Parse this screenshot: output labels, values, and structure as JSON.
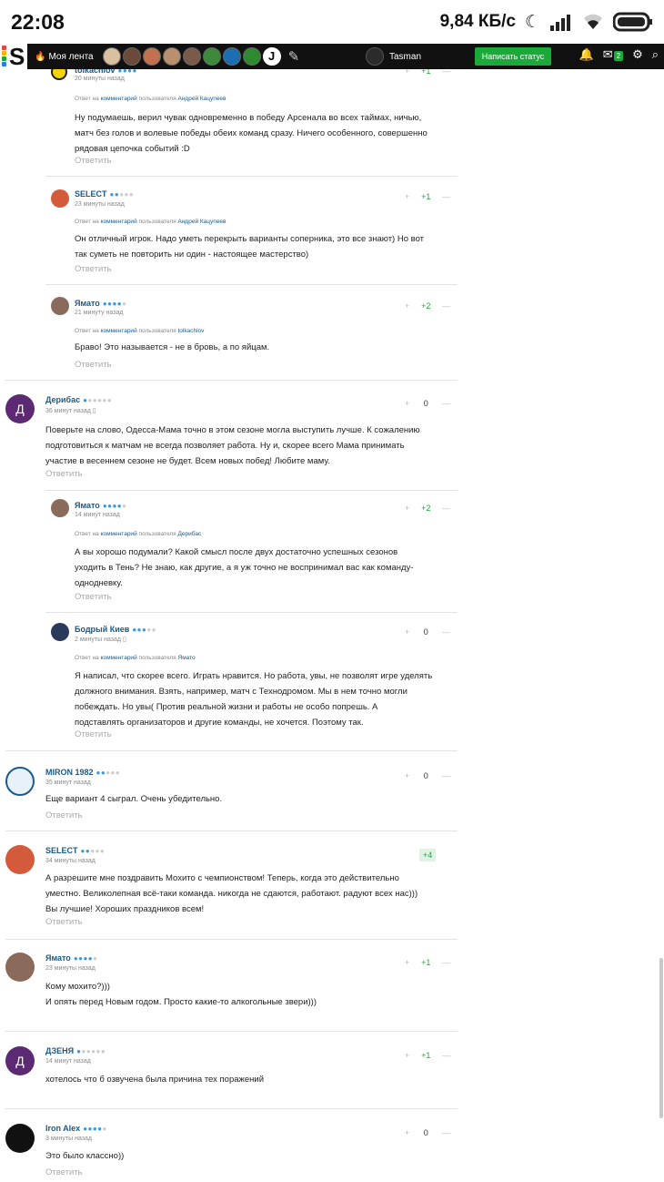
{
  "status_bar": {
    "time": "22:08",
    "speed": "9,84 КБ/с"
  },
  "nav": {
    "feed_label": "Моя лента",
    "username": "Tasman",
    "status_button": "Написать статус",
    "mail_count": "2"
  },
  "comments": [
    {
      "name": "tolkachiov",
      "rank_on": 4,
      "rank_total": 5,
      "time": "20 минуты назад",
      "reply": {
        "prefix": "Ответ на",
        "link": "комментарий",
        "mid": "пользователя",
        "user": "Андрей Кацупеев"
      },
      "text": "Ну подумаешь, верил чувак одновременно в победу Арсенала во всех таймах, ничью,\nматч без голов и волевые победы обеих команд сразу. Ничего особенного, совершенно\nрядовая цепочка событий :D",
      "score": "+1",
      "answer": "Ответить"
    },
    {
      "name": "SELECT",
      "rank_on": 2,
      "rank_total": 5,
      "time": "23 минуты назад",
      "reply": {
        "prefix": "Ответ на",
        "link": "комментарий",
        "mid": "пользователя",
        "user": "Андрей Кацупеев"
      },
      "text": "Он отличный игрок. Надо уметь перекрыть варианты соперника, это все знают) Но вот\nтак суметь не повторить ни один - настоящее мастерство)",
      "score": "+1",
      "answer": "Ответить"
    },
    {
      "name": "Ямато",
      "rank_on": 4,
      "rank_total": 5,
      "time": "21 минуту назад",
      "reply": {
        "prefix": "Ответ на",
        "link": "комментарий",
        "mid": "пользователя",
        "user": "tolkachiov"
      },
      "text": "Браво! Это называется - не в бровь, а по яйцам.",
      "score": "+2",
      "answer": "Ответить"
    },
    {
      "name": "Дерибас",
      "rank_on": 1,
      "rank_total": 6,
      "time": "36 минут назад",
      "letter": "Д",
      "text": "Поверьте на слово, Одесса-Мама точно в этом сезоне могла выступить лучше. К сожалению\nподготовиться к матчам не всегда позволяет работа. Ну и, скорее всего Мама принимать\nучастие в весеннем сезоне не будет. Всем новых побед! Любите маму.",
      "score": "0",
      "answer": "Ответить"
    },
    {
      "name": "Ямато",
      "rank_on": 4,
      "rank_total": 5,
      "time": "14 минут назад",
      "reply": {
        "prefix": "Ответ на",
        "link": "комментарий",
        "mid": "пользователя",
        "user": "Дерибас"
      },
      "text": "А вы хорошо подумали? Какой смысл после двух достаточно успешных сезонов\nуходить в Тень? Не знаю, как другие, а я уж точно не воспринимал вас как команду-\nоднодневку.",
      "score": "+2",
      "answer": "Ответить"
    },
    {
      "name": "Бодрый Киев",
      "rank_on": 3,
      "rank_total": 5,
      "time": "2 минуты назад",
      "reply": {
        "prefix": "Ответ на",
        "link": "комментарий",
        "mid": "пользователя",
        "user": "Ямато"
      },
      "text": "Я написал, что скорее всего. Играть нравится. Но работа, увы, не позволят игре уделять\nдолжного внимания. Взять, например, матч с Технодромом. Мы в нем точно могли\nпобеждать. Но увы( Против реальной жизни и работы не особо попрешь. А\nподставлять организаторов и другие команды, не хочется. Поэтому так.",
      "score": "0",
      "answer": "Ответить"
    },
    {
      "name": "MIRON 1982",
      "rank_on": 2,
      "rank_total": 5,
      "time": "35 минут назад",
      "text": "Еще вариант 4 сыграл. Очень убедительно.",
      "score": "0",
      "answer": "Ответить"
    },
    {
      "name": "SELECT",
      "rank_on": 2,
      "rank_total": 5,
      "time": "34 минуты назад",
      "text": "А разрешите мне поздравить Мохито с чемпионством! Теперь, когда это действительно\nуместно. Великолепная всё-таки команда. никогда не сдаются, работают. радуют всех нас)))\nВы лучшие! Хороших праздников всем!",
      "score": "+4",
      "answer": "Ответить"
    },
    {
      "name": "Ямато",
      "rank_on": 4,
      "rank_total": 5,
      "time": "23 минуты назад",
      "text": "Кому мохито?)))\nИ опять перед Новым годом. Просто какие-то алкогольные звери)))",
      "score": "+1",
      "answer": ""
    },
    {
      "name": "ДЗЕНЯ",
      "rank_on": 1,
      "rank_total": 6,
      "time": "14 минут назад",
      "letter": "Д",
      "text": "хотелось что б озвучена была причина тех поражений",
      "score": "+1",
      "answer": ""
    },
    {
      "name": "Iron Alex",
      "rank_on": 4,
      "rank_total": 5,
      "time": "3 минуты назад",
      "text": "Это было классно))",
      "score": "0",
      "answer": "Ответить"
    }
  ]
}
